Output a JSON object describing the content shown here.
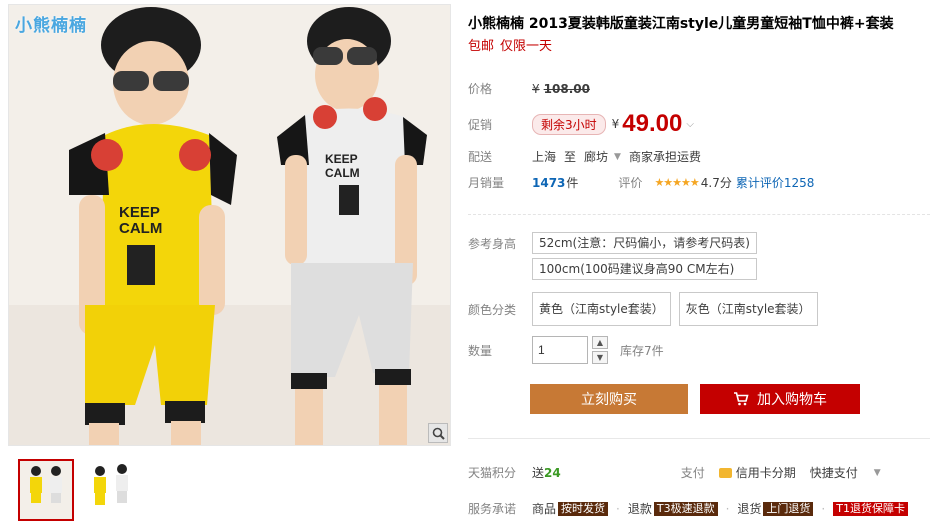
{
  "brand_watermark": "小熊楠楠",
  "title": "小熊楠楠 2013夏装韩版童装江南style儿童男童短袖T恤中裤+套装",
  "subtitle": [
    "包邮",
    "仅限一天"
  ],
  "price": {
    "label": "价格",
    "currency": "¥",
    "original": "108.00"
  },
  "promo": {
    "label": "促销",
    "countdown": "剩余3小时",
    "currency": "¥",
    "price": "49.00"
  },
  "shipping": {
    "label": "配送",
    "from": "上海",
    "to_word": "至",
    "destination": "廊坊",
    "fee_note": "商家承担运费"
  },
  "sales": {
    "label": "月销量",
    "count": "1473",
    "unit": "件",
    "rating_label": "评价",
    "stars": "★★★★★",
    "rating": "4.7分",
    "review_text": "累计评价1258"
  },
  "sku": {
    "height_label": "参考身高",
    "heights": [
      "52cm(注意：尺码偏小，请参考尺码表)",
      "100cm(100码建议身高90 CM左右)"
    ],
    "color_label": "颜色分类",
    "colors": [
      "黄色（江南style套装）",
      "灰色（江南style套装）"
    ]
  },
  "quantity": {
    "label": "数量",
    "value": "1",
    "stock": "库存7件"
  },
  "buttons": {
    "buy_now": "立刻购买",
    "add_to_cart": "加入购物车"
  },
  "points": {
    "label": "天猫积分",
    "prefix": "送",
    "value": "24"
  },
  "payment": {
    "label": "支付",
    "credit": "信用卡分期",
    "express": "快捷支付"
  },
  "service": {
    "label": "服务承诺",
    "items": [
      {
        "key": "商品",
        "badge": "按时发货"
      },
      {
        "key": "退款",
        "badge": "T3极速退款"
      },
      {
        "key": "退货",
        "badge": "上门退货"
      },
      {
        "key": "",
        "badge": "T1退货保障卡"
      }
    ]
  },
  "colors": {
    "accent_red": "#c40000",
    "buy_now_orange": "#c77935",
    "link_blue": "#0e66b5",
    "points_green": "#3c9a25",
    "star_gold": "#f5a623"
  }
}
